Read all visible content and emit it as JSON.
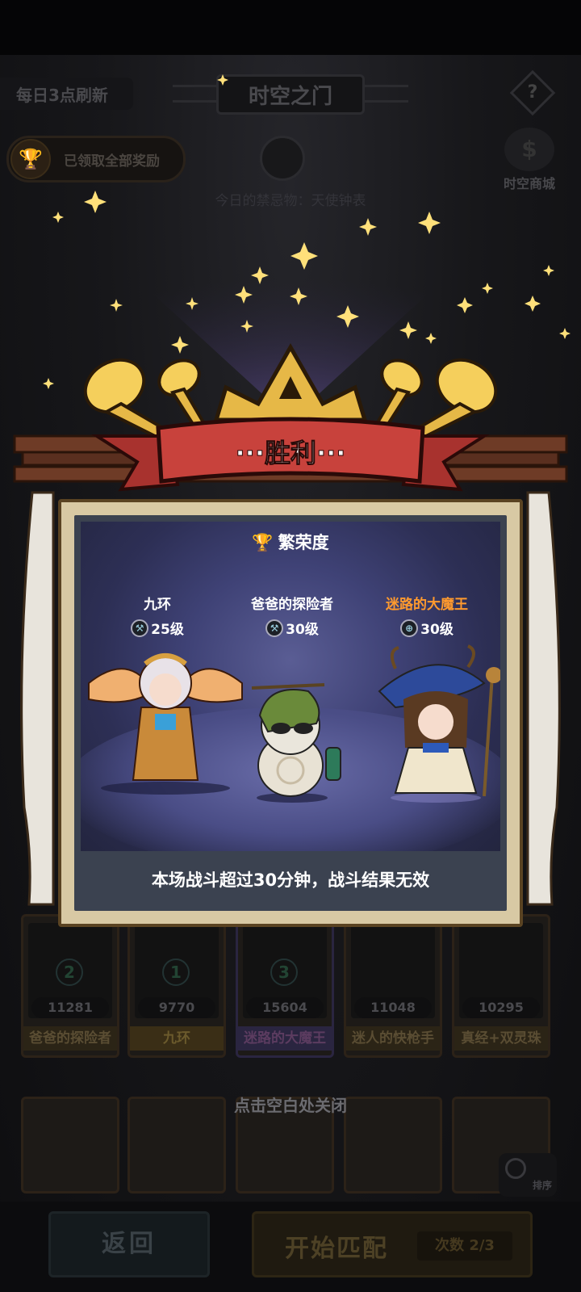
{
  "header": {
    "refresh_label": "每日3点刷新",
    "title": "时空之门",
    "help_label": "?",
    "reward_label": "已领取全部奖励",
    "shop_label": "时空商城",
    "today_item": "今日的禁忌物：天使钟表"
  },
  "victory": {
    "banner_text": "···胜利···",
    "prosperity_label": "繁荣度",
    "heroes": [
      {
        "name": "九环",
        "level": "25级"
      },
      {
        "name": "爸爸的探险者",
        "level": "30级"
      },
      {
        "name": "迷路的大魔王",
        "level": "30级"
      }
    ],
    "notice": "本场战斗超过30分钟，战斗结果无效"
  },
  "roster": [
    {
      "slot": "2",
      "power": "11281",
      "name": "爸爸的探险者"
    },
    {
      "slot": "1",
      "power": "9770",
      "name": "九环"
    },
    {
      "slot": "3",
      "power": "15604",
      "name": "迷路的大魔王"
    },
    {
      "slot": "",
      "power": "11048",
      "name": "迷人的快枪手"
    },
    {
      "slot": "",
      "power": "10295",
      "name": "真经+双灵珠"
    }
  ],
  "close_hint": "点击空白处关闭",
  "sort_label": "排序",
  "footer": {
    "back_label": "返回",
    "match_label": "开始匹配",
    "count_label": "次数 2/3"
  },
  "colors": {
    "accent_gold": "#e6b847",
    "banner_red": "#c8423c",
    "special_name": "#ff9a2e"
  }
}
